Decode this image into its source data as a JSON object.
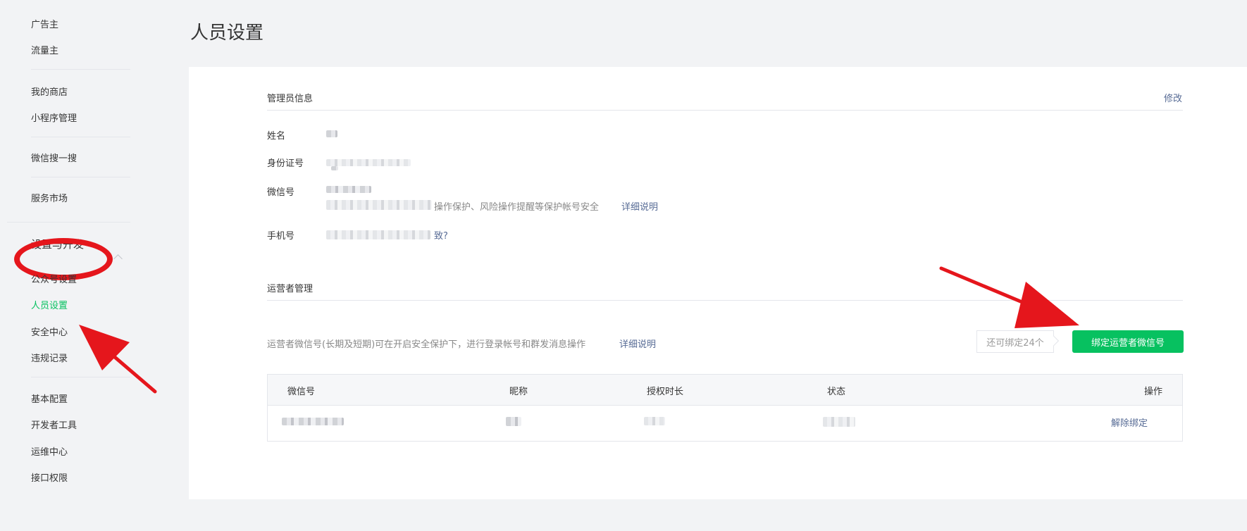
{
  "sidebar": {
    "items": [
      {
        "label": "广告主"
      },
      {
        "label": "流量主"
      },
      {
        "label": "我的商店"
      },
      {
        "label": "小程序管理"
      },
      {
        "label": "微信搜一搜"
      },
      {
        "label": "服务市场"
      },
      {
        "label": "设置与开发"
      },
      {
        "label": "公众号设置"
      },
      {
        "label": "人员设置"
      },
      {
        "label": "安全中心"
      },
      {
        "label": "违规记录"
      },
      {
        "label": "基本配置"
      },
      {
        "label": "开发者工具"
      },
      {
        "label": "运维中心"
      },
      {
        "label": "接口权限"
      }
    ],
    "active_item": "人员设置",
    "accent_color": "#07c160"
  },
  "page": {
    "title": "人员设置"
  },
  "admin": {
    "section_title": "管理员信息",
    "edit_link": "修改",
    "name_label": "姓名",
    "id_label": "身份证号",
    "wechat_label": "微信号",
    "wechat_desc": "操作保护、风险操作提醒等保护帐号安全",
    "wechat_detail_link": "详细说明",
    "phone_label": "手机号",
    "phone_suffix_link": "致?"
  },
  "operators": {
    "section_title": "运营者管理",
    "description": "运营者微信号(长期及短期)可在开启安全保护下，进行登录帐号和群发消息操作",
    "detail_link": "详细说明",
    "quota_text": "还可绑定24个",
    "bind_button": "绑定运营者微信号",
    "table": {
      "headers": [
        "微信号",
        "昵称",
        "授权时长",
        "状态",
        "操作"
      ],
      "rows": [
        {
          "action": "解除绑定"
        }
      ]
    }
  },
  "colors": {
    "link": "#576b95",
    "primary_button": "#07c160",
    "annotation": "#e5161c"
  }
}
